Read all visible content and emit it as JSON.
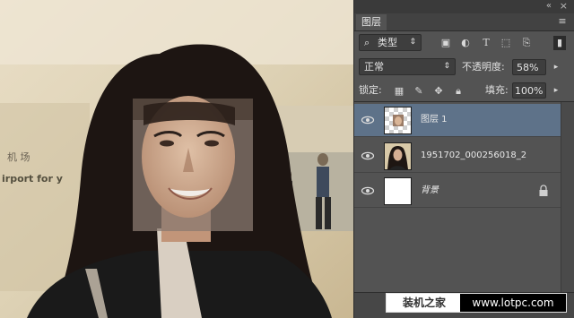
{
  "panel": {
    "tab_label": "图层",
    "filter_label": "类型",
    "blend_mode": "正常",
    "opacity_label": "不透明度:",
    "opacity_value": "58%",
    "lock_label": "锁定:",
    "fill_label": "填充:",
    "fill_value": "100%"
  },
  "layers": [
    {
      "name": "图层 1"
    },
    {
      "name": "1951702_000256018_2"
    },
    {
      "name": "背景"
    }
  ],
  "canvas": {
    "sign_line1": "机 场",
    "sign_line2": "irport for y"
  },
  "watermark": {
    "left": "装机之家",
    "right": "www.lotpc.com"
  },
  "colors": {
    "selected_layer": "#5e7289",
    "panel_bg": "#535353"
  }
}
